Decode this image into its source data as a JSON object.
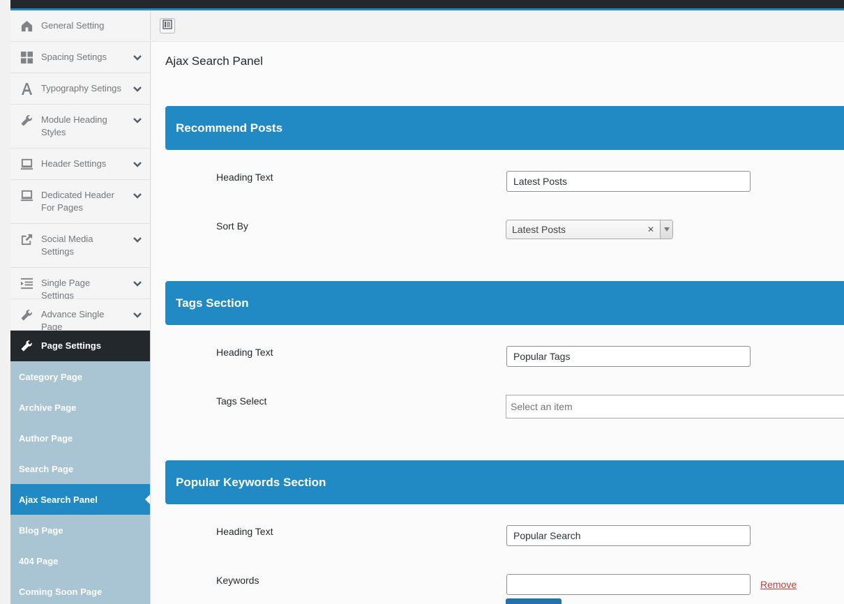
{
  "sidebar": {
    "items": [
      {
        "label": "General Setting",
        "icon": "home-icon",
        "chevron": false
      },
      {
        "label": "Spacing Setings",
        "icon": "grid-icon",
        "chevron": true
      },
      {
        "label": "Typography Setings",
        "icon": "typography-icon",
        "chevron": true
      },
      {
        "label": "Module Heading Styles",
        "icon": "wrench-icon",
        "chevron": true
      },
      {
        "label": "Header Settings",
        "icon": "monitor-icon",
        "chevron": true
      },
      {
        "label": "Dedicated Header For Pages",
        "icon": "monitor-icon",
        "chevron": true
      },
      {
        "label": "Social Media Settings",
        "icon": "share-icon",
        "chevron": true
      },
      {
        "label": "Single Page Settings",
        "icon": "list-icon",
        "chevron": true
      },
      {
        "label": "Advance Single Page",
        "icon": "wrench-icon",
        "chevron": true
      },
      {
        "label": "Page Settings",
        "icon": "wrench-icon",
        "chevron": false
      }
    ],
    "sub_items": [
      {
        "label": "Category Page"
      },
      {
        "label": "Archive Page"
      },
      {
        "label": "Author Page"
      },
      {
        "label": "Search Page"
      },
      {
        "label": "Ajax Search Panel"
      },
      {
        "label": "Blog Page"
      },
      {
        "label": "404 Page"
      },
      {
        "label": "Coming Soon Page"
      }
    ]
  },
  "main": {
    "title": "Ajax Search Panel",
    "sections": [
      {
        "heading": "Recommend Posts",
        "fields": [
          {
            "label": "Heading Text",
            "value": "Latest Posts"
          },
          {
            "label": "Sort By",
            "value": "Latest Posts"
          }
        ]
      },
      {
        "heading": "Tags Section",
        "fields": [
          {
            "label": "Heading Text",
            "value": "Popular Tags"
          },
          {
            "label": "Tags Select",
            "placeholder": "Select an item"
          }
        ]
      },
      {
        "heading": "Popular Keywords Section",
        "fields": [
          {
            "label": "Heading Text",
            "value": "Popular Search"
          },
          {
            "label": "Keywords",
            "value": "",
            "remove_label": "Remove"
          }
        ]
      }
    ]
  },
  "colors": {
    "accent": "#2189c4",
    "dark": "#23282d",
    "submenu": "#a9c4d2",
    "remove": "#d63638"
  }
}
